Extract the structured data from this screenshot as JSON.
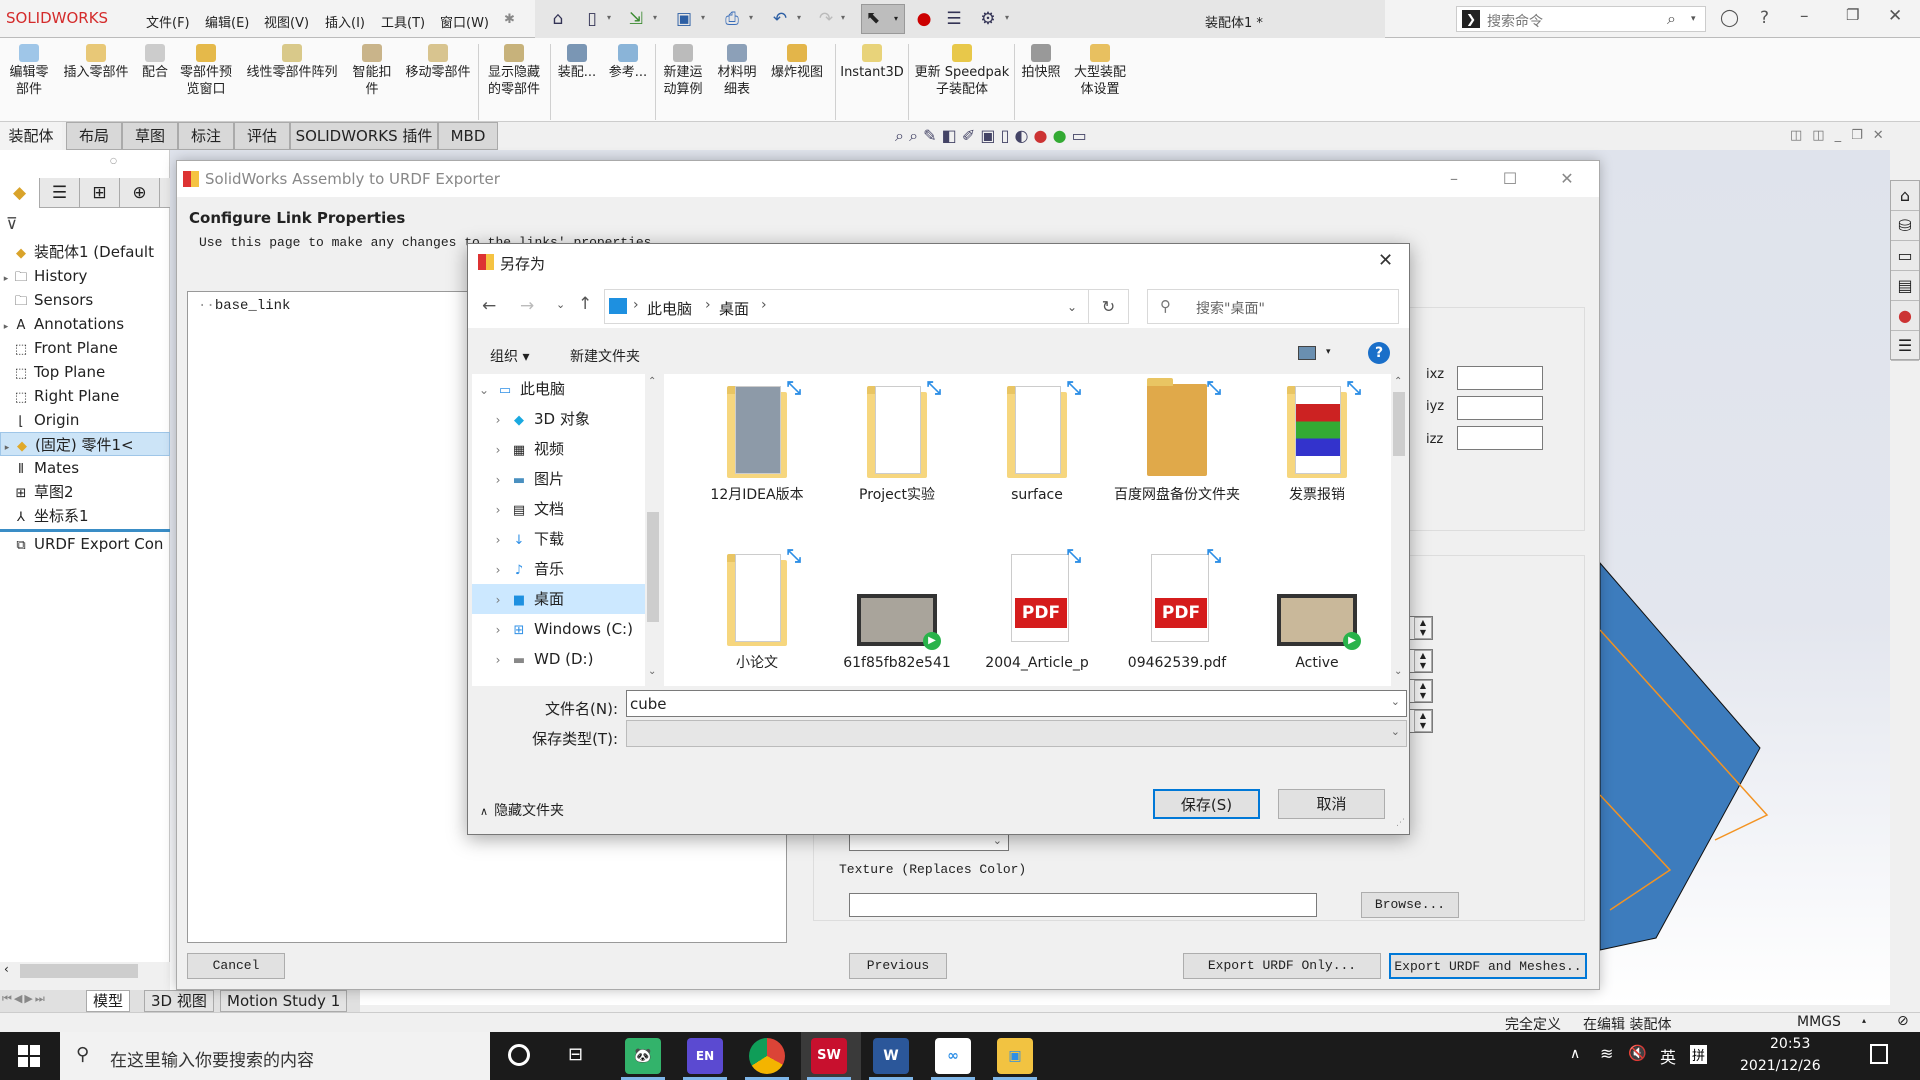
{
  "app": {
    "logo": "SOLIDWORKS",
    "menu": [
      "文件(F)",
      "编辑(E)",
      "视图(V)",
      "插入(I)",
      "工具(T)",
      "窗口(W)"
    ],
    "document_title": "装配体1 *",
    "search_placeholder": "搜索命令"
  },
  "commandbar": [
    {
      "label": "编辑零\n部件"
    },
    {
      "label": "插入零部件"
    },
    {
      "label": "配合"
    },
    {
      "label": "零部件预\n览窗口"
    },
    {
      "label": "线性零部件阵列"
    },
    {
      "label": "智能扣\n件"
    },
    {
      "label": "移动零部件"
    },
    {
      "label": "显示隐藏\n的零部件"
    },
    {
      "label": "装配..."
    },
    {
      "label": "参考..."
    },
    {
      "label": "新建运\n动算例"
    },
    {
      "label": "材料明\n细表"
    },
    {
      "label": "爆炸视图"
    },
    {
      "label": "Instant3D"
    },
    {
      "label": "更新 Speedpak\n子装配体"
    },
    {
      "label": "拍快照"
    },
    {
      "label": "大型装配\n体设置"
    }
  ],
  "tabs": [
    "装配体",
    "布局",
    "草图",
    "标注",
    "评估",
    "SOLIDWORKS 插件",
    "MBD"
  ],
  "feature_tree": [
    {
      "label": "装配体1  (Default",
      "icon": "assembly-icon",
      "expand": ""
    },
    {
      "label": "History",
      "icon": "history-icon",
      "expand": "▸"
    },
    {
      "label": "Sensors",
      "icon": "sensors-icon",
      "expand": ""
    },
    {
      "label": "Annotations",
      "icon": "annotations-icon",
      "expand": "▸"
    },
    {
      "label": "Front Plane",
      "icon": "plane-icon",
      "expand": ""
    },
    {
      "label": "Top Plane",
      "icon": "plane-icon",
      "expand": ""
    },
    {
      "label": "Right Plane",
      "icon": "plane-icon",
      "expand": ""
    },
    {
      "label": "Origin",
      "icon": "origin-icon",
      "expand": ""
    },
    {
      "label": "(固定) 零件1<",
      "icon": "part-icon",
      "expand": "▸",
      "selected": true
    },
    {
      "label": "Mates",
      "icon": "mates-icon",
      "expand": ""
    },
    {
      "label": "草图2",
      "icon": "sketch-icon",
      "expand": ""
    },
    {
      "label": "坐标系1",
      "icon": "coordinate-system-icon",
      "expand": ""
    },
    {
      "label": "URDF Export Con",
      "icon": "urdf-config-icon",
      "expand": ""
    }
  ],
  "bottom_tabs": [
    "模型",
    "3D 视图",
    "Motion Study 1"
  ],
  "status": {
    "definition": "完全定义",
    "editing": "在编辑 装配体",
    "units": "MMGS"
  },
  "urdf_exporter": {
    "title": "SolidWorks Assembly to URDF Exporter",
    "heading": "Configure Link Properties",
    "subtitle": "Use this page to make any changes to the links' properties",
    "tree_root": "base_link",
    "inertia_labels": [
      "ixz",
      "iyz",
      "izz"
    ],
    "texture_label": "Texture (Replaces Color)",
    "texture_value": "",
    "browse": "Browse...",
    "cancel": "Cancel",
    "previous": "Previous",
    "export_urdf_only": "Export URDF Only...",
    "export_urdf_meshes": "Export URDF and Meshes.."
  },
  "save_as": {
    "title": "另存为",
    "breadcrumb": [
      "此电脑",
      "桌面"
    ],
    "search_placeholder": "搜索\"桌面\"",
    "organize": "组织 ▾",
    "new_folder": "新建文件夹",
    "nav": [
      {
        "label": "此电脑",
        "expand": "⌄",
        "icon": "this-pc-icon"
      },
      {
        "label": "3D 对象",
        "expand": "›",
        "icon": "3d-objects-icon"
      },
      {
        "label": "视频",
        "expand": "›",
        "icon": "videos-icon"
      },
      {
        "label": "图片",
        "expand": "›",
        "icon": "pictures-icon"
      },
      {
        "label": "文档",
        "expand": "›",
        "icon": "documents-icon"
      },
      {
        "label": "下载",
        "expand": "›",
        "icon": "downloads-icon"
      },
      {
        "label": "音乐",
        "expand": "›",
        "icon": "music-icon"
      },
      {
        "label": "桌面",
        "expand": "›",
        "icon": "desktop-icon",
        "selected": true
      },
      {
        "label": "Windows (C:)",
        "expand": "›",
        "icon": "drive-c-icon"
      },
      {
        "label": "WD (D:)",
        "expand": "›",
        "icon": "drive-d-icon"
      }
    ],
    "files": [
      {
        "name": "12月IDEA版本",
        "type": "folder"
      },
      {
        "name": "Project实验",
        "type": "folder"
      },
      {
        "name": "surface",
        "type": "folder"
      },
      {
        "name": "百度网盘备份文件夹",
        "type": "baidu-folder"
      },
      {
        "name": "发票报销",
        "type": "folder"
      },
      {
        "name": "小论文",
        "type": "folder"
      },
      {
        "name": "61f85fb82e541",
        "type": "video"
      },
      {
        "name": "2004_Article_p",
        "type": "pdf"
      },
      {
        "name": "09462539.pdf",
        "type": "pdf"
      },
      {
        "name": "Active",
        "type": "video"
      }
    ],
    "filename_label": "文件名(N):",
    "filename": "cube",
    "filetype_label": "保存类型(T):",
    "filetype": "",
    "hide_folders": "隐藏文件夹",
    "save": "保存(S)",
    "cancel": "取消"
  },
  "taskbar": {
    "search_placeholder": "在这里输入你要搜索的内容",
    "time": "20:53",
    "date": "2021/12/26",
    "ime_lang": "英",
    "ime_mode": "拼"
  },
  "colors": {
    "accent": "#0078d7",
    "solidworks_red": "#d42b2b",
    "model_blue": "#3d7cbd",
    "sketch_orange": "#f39322"
  }
}
